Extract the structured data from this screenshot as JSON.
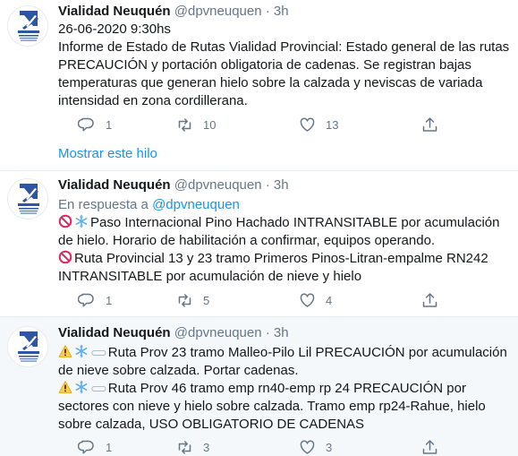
{
  "tweets": [
    {
      "name": "Vialidad Neuquén",
      "handle": "@dpvneuquen",
      "separator": "·",
      "time": "3h",
      "lines": [
        "26-06-2020 9:30hs",
        "Informe de Estado de Rutas Vialidad Provincial: Estado general de las rutas PRECAUCIÓN  y portación obligatoria de cadenas. Se registran bajas temperaturas que generan hielo sobre la calzada y neviscas de variada intensidad en zona cordillerana."
      ],
      "replies": "1",
      "retweets": "10",
      "likes": "13",
      "show_thread": "Mostrar este hilo"
    },
    {
      "name": "Vialidad Neuquén",
      "handle": "@dpvneuquen",
      "separator": "·",
      "time": "3h",
      "reply_prefix": "En respuesta a",
      "reply_to": "@dpvneuquen",
      "lines": [
        "Paso Internacional Pino Hachado INTRANSITABLE por acumulación de hielo. Horario de habilitación a confirmar, equipos operando.",
        "Ruta Provincial 13 y 23 tramo Primeros Pinos-Litran-empalme RN242 INTRANSITABLE por acumulación de nieve y hielo"
      ],
      "replies": "1",
      "retweets": "5",
      "likes": "4"
    },
    {
      "name": "Vialidad Neuquén",
      "handle": "@dpvneuquen",
      "separator": "·",
      "time": "3h",
      "lines": [
        "Ruta Prov 23 tramo Malleo-Pilo Lil PRECAUCIÓN por acumulación de nieve sobre calzada. Portar cadenas.",
        "Ruta Prov 46 tramo emp rn40-emp rp 24 PRECAUCIÓN por sectores con nieve y hielo sobre calzada. Tramo emp rp24-Rahue, hielo sobre calzada, USO OBLIGATORIO DE CADENAS"
      ],
      "replies": "1",
      "retweets": "3",
      "likes": "3"
    }
  ],
  "icons": {
    "prohibited": "no-entry-sign-icon",
    "snowflake": "snowflake-icon",
    "warning": "warning-sign-icon",
    "chain": "chain-icon"
  },
  "colors": {
    "link": "#1b95e0",
    "muted": "#657786",
    "highlight_bg": "#f5f8fa",
    "divider": "#e6ecf0"
  }
}
